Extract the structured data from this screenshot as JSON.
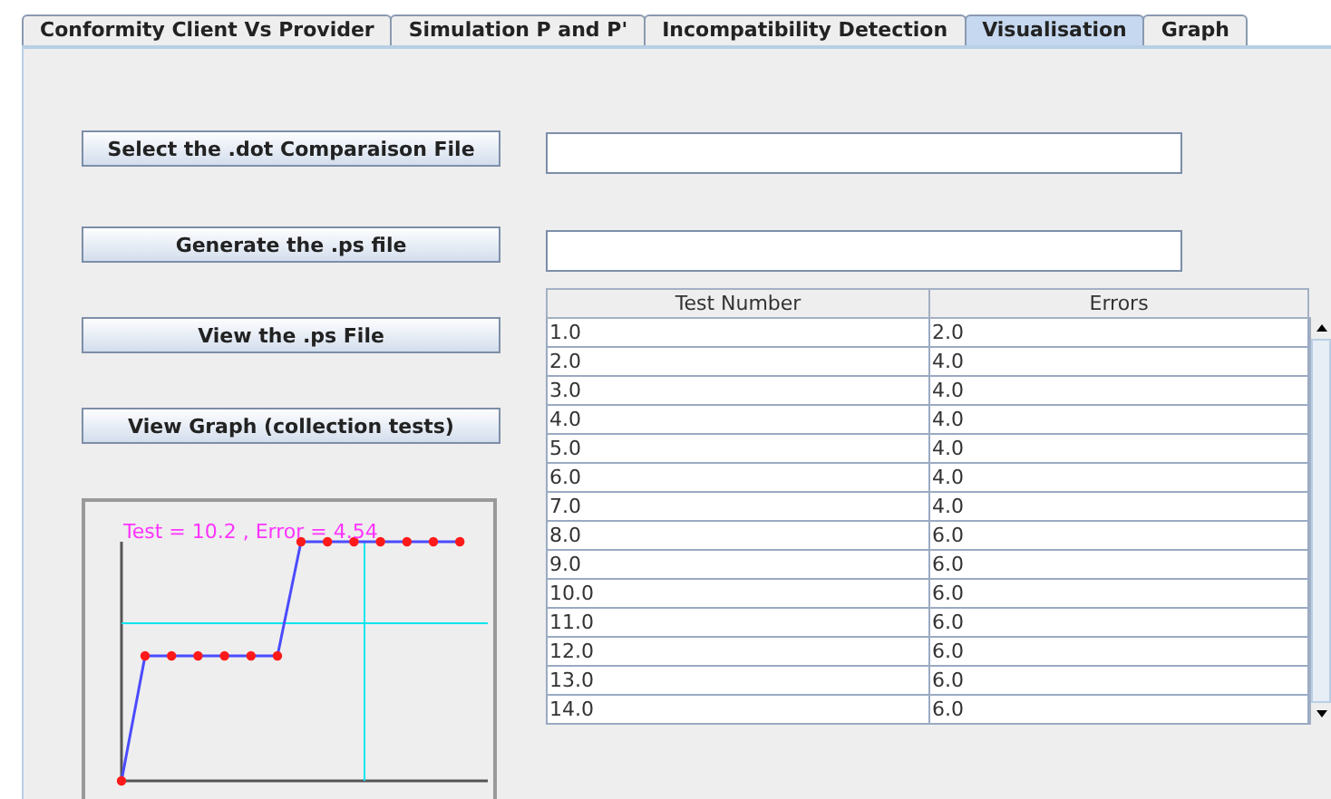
{
  "tabs": [
    {
      "label": "Conformity Client Vs Provider",
      "selected": false
    },
    {
      "label": "Simulation P and P'",
      "selected": false
    },
    {
      "label": "Incompatibility Detection",
      "selected": false
    },
    {
      "label": "Visualisation",
      "selected": true
    },
    {
      "label": "Graph",
      "selected": false
    }
  ],
  "buttons": [
    "Select the .dot Comparaison File",
    "Generate the .ps file",
    "View the .ps File",
    "View Graph (collection tests)"
  ],
  "fields": [
    {
      "kind": "text"
    },
    {
      "kind": "text"
    }
  ],
  "table": {
    "columns": [
      "Test Number",
      "Errors"
    ],
    "rows": [
      [
        "1.0",
        "2.0"
      ],
      [
        "2.0",
        "4.0"
      ],
      [
        "3.0",
        "4.0"
      ],
      [
        "4.0",
        "4.0"
      ],
      [
        "5.0",
        "4.0"
      ],
      [
        "6.0",
        "4.0"
      ],
      [
        "7.0",
        "4.0"
      ],
      [
        "8.0",
        "6.0"
      ],
      [
        "9.0",
        "6.0"
      ],
      [
        "10.0",
        "6.0"
      ],
      [
        "11.0",
        "6.0"
      ],
      [
        "12.0",
        "6.0"
      ],
      [
        "13.0",
        "6.0"
      ],
      [
        "14.0",
        "6.0"
      ]
    ]
  },
  "graph": {
    "readout": "Test = 10.2 , Error = 4.54"
  }
}
